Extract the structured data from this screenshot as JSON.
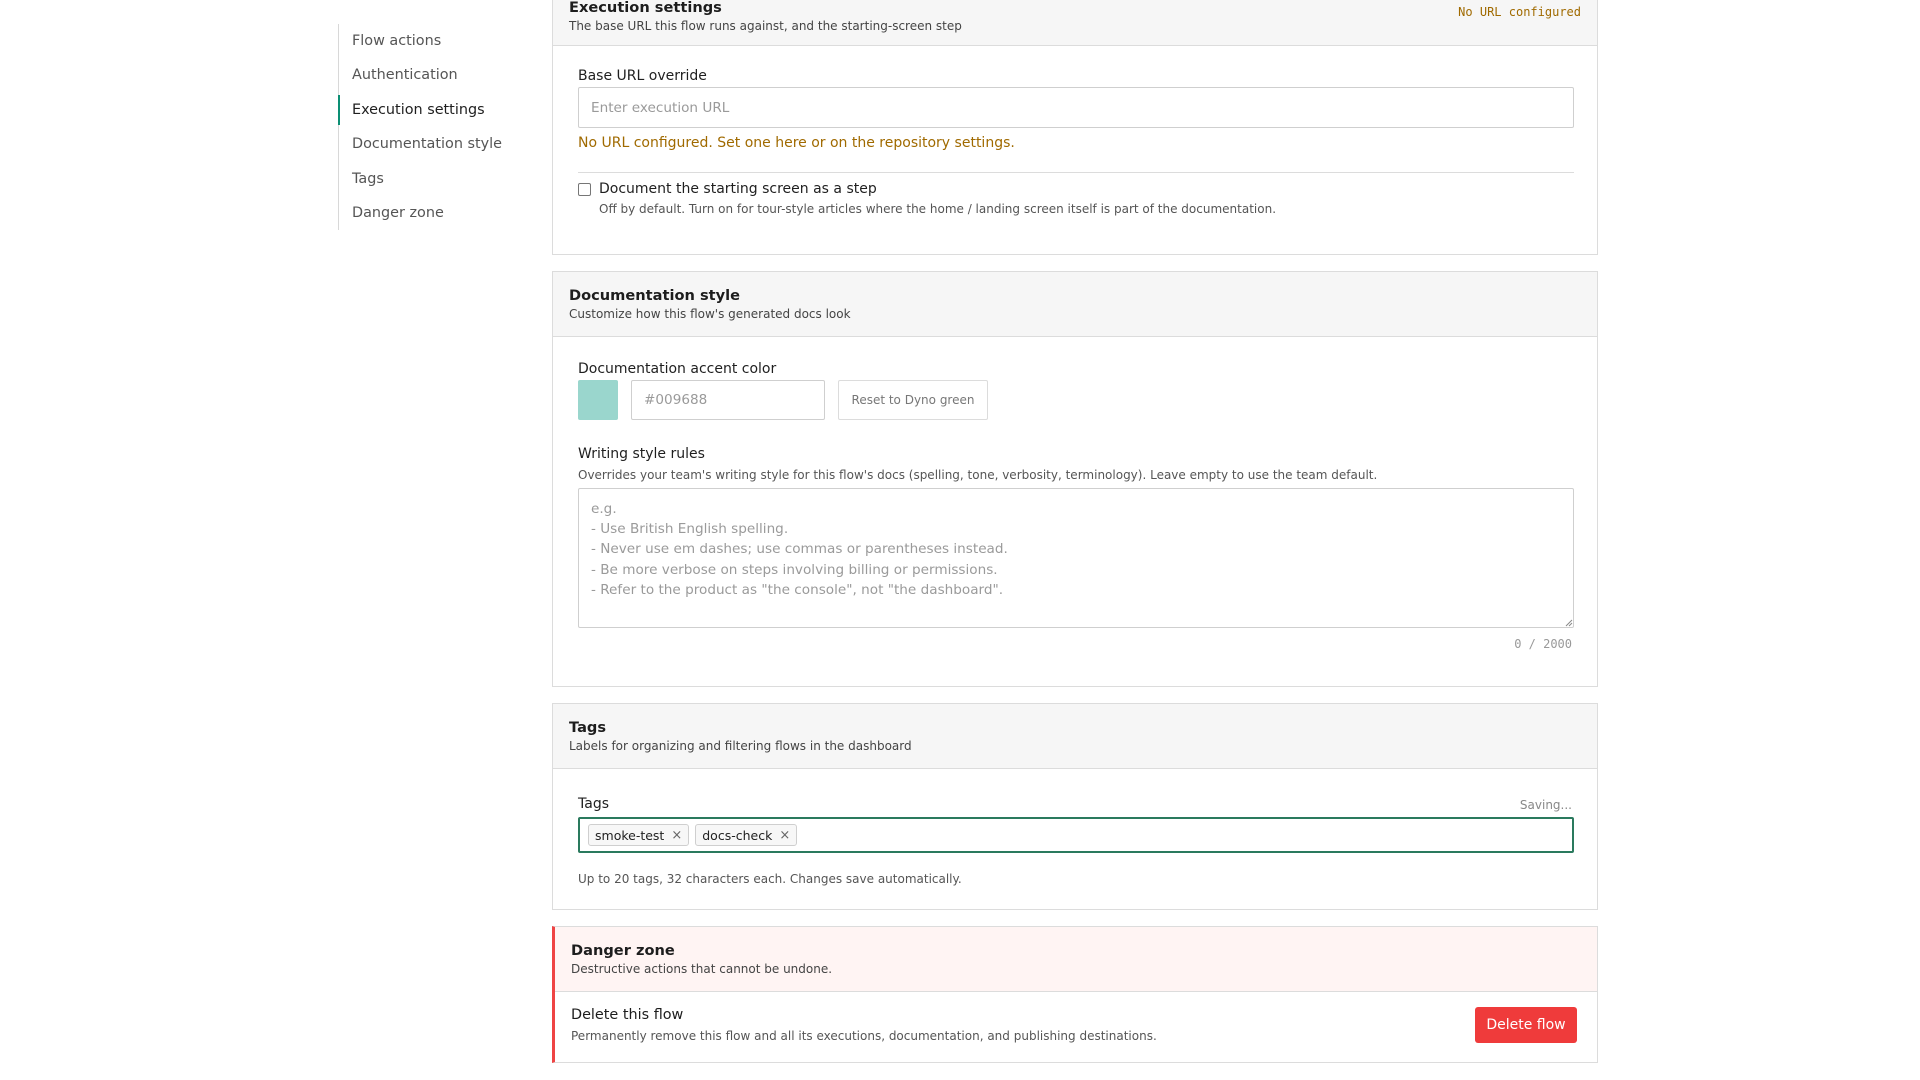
{
  "nav": {
    "items": [
      {
        "label": "Flow actions"
      },
      {
        "label": "Authentication"
      },
      {
        "label": "Execution settings"
      },
      {
        "label": "Documentation style"
      },
      {
        "label": "Tags"
      },
      {
        "label": "Danger zone"
      }
    ],
    "active_index": 2
  },
  "execution": {
    "title": "Execution settings",
    "subtitle": "The base URL this flow runs against, and the starting-screen step",
    "status": "No URL configured",
    "base_url_label": "Base URL override",
    "base_url_placeholder": "Enter execution URL",
    "base_url_value": "",
    "warning": "No URL configured. Set one here or on the repository settings.",
    "start_step_label": "Document the starting screen as a step",
    "start_step_checked": false,
    "start_step_help": "Off by default. Turn on for tour-style articles where the home / landing screen itself is part of the documentation."
  },
  "doc_style": {
    "title": "Documentation style",
    "subtitle": "Customize how this flow's generated docs look",
    "accent_label": "Documentation accent color",
    "accent_swatch_color": "#9ad6cd",
    "accent_placeholder": "#009688",
    "reset_label": "Reset to Dyno green",
    "rules_label": "Writing style rules",
    "rules_help": "Overrides your team's writing style for this flow's docs (spelling, tone, verbosity, terminology). Leave empty to use the team default.",
    "rules_placeholder": "e.g.\n- Use British English spelling.\n- Never use em dashes; use commas or parentheses instead.\n- Be more verbose on steps involving billing or permissions.\n- Refer to the product as \"the console\", not \"the dashboard\".",
    "rules_counter": "0 / 2000"
  },
  "tags": {
    "title": "Tags",
    "subtitle": "Labels for organizing and filtering flows in the dashboard",
    "field_label": "Tags",
    "saving_text": "Saving...",
    "items": [
      {
        "label": "smoke-test"
      },
      {
        "label": "docs-check"
      }
    ],
    "help": "Up to 20 tags, 32 characters each. Changes save automatically."
  },
  "danger": {
    "title": "Danger zone",
    "subtitle": "Destructive actions that cannot be undone.",
    "delete_title": "Delete this flow",
    "delete_help": "Permanently remove this flow and all its executions, documentation, and publishing destinations.",
    "delete_button": "Delete flow"
  },
  "colors": {
    "accent": "#0c8f74",
    "warning": "#a06a00",
    "danger": "#ef3b3b",
    "tags_focus_border": "#2a7a5e"
  }
}
